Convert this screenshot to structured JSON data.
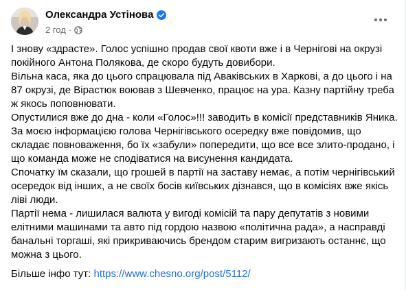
{
  "post": {
    "author": "Олександра Устінова",
    "time": "2 год",
    "dot": "·",
    "paragraphs": [
      "І знову «здрасте». Голос успішно продав свої квоти вже і в Чернігові на окрузі покійного Антона Полякова, де скоро будуть довибори.",
      "Вільна каса, яка до цього спрацювала під Аваківських в Харкові, а до цього і на 87 окрузі, де Вірастюк воював з Шевченко, працює на ура. Казну партійну треба ж якось поповнювати.",
      "Опустилися вже до дна - коли «Голос»!!! заводить в комісії представників Яника.",
      "За моєю інформацією голова Чернігівського осередку вже повідомив, що складає повноваження, бо їх «забули» попередити, що все все злито-продано, і що команда може не сподіватися на висунення кандидата.",
      "Спочатку їм сказали, що грошей в партії на заставу немає, а потім чернігівський осередок від інших, а не своїх босів київських дізнався, що в комісіях вже якісь ліві люди.",
      "Партії нема - лишилася валюта у вигоді комісій та пару депутатів з новими елітними машинами та  авто під гордою назвою «політична рада», а насправді банальні торгаші, які прикриваючись брендом старим вигризають останнє, що можна з цього."
    ],
    "more_info_label": "Більше інфо тут: ",
    "more_info_link": "https://www.chesno.org/post/5112/"
  },
  "icons": {
    "verified": "verified-badge-icon",
    "privacy": "globe-icon",
    "more": "more-options-icon"
  },
  "colors": {
    "verified": "#1877f2",
    "link": "#216fdb",
    "secondary_text": "#65676b"
  }
}
